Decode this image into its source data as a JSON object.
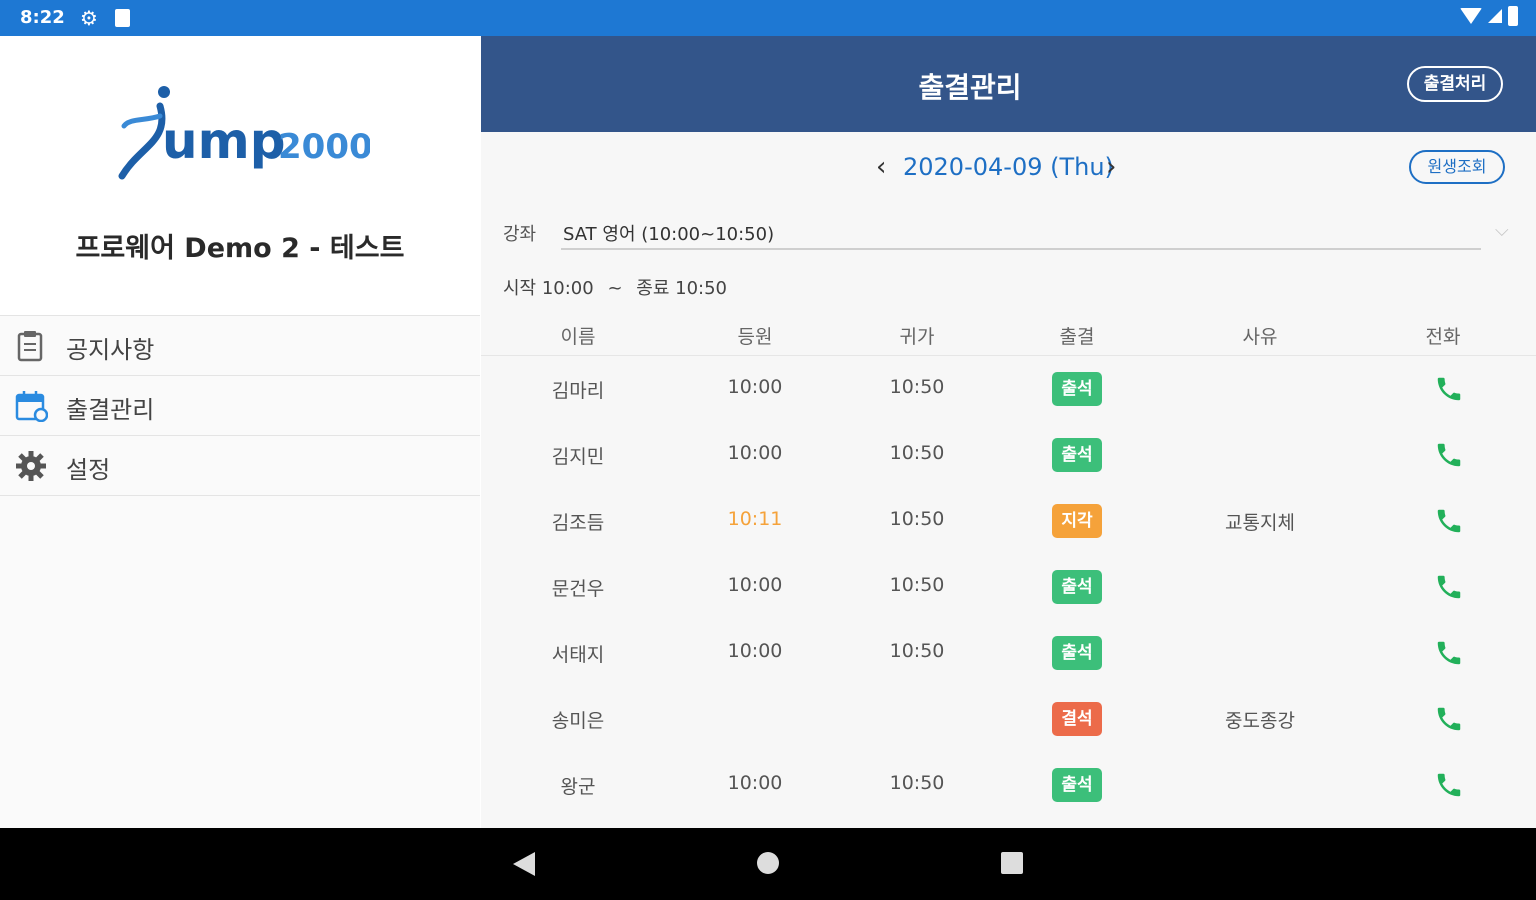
{
  "status_bar": {
    "time": "8:22"
  },
  "sidebar": {
    "org_name": "프로웨어 Demo 2 - 테스트",
    "items": [
      {
        "label": "공지사항",
        "icon": "notice-icon"
      },
      {
        "label": "출결관리",
        "icon": "calendar-icon"
      },
      {
        "label": "설정",
        "icon": "gear-icon"
      }
    ]
  },
  "appbar": {
    "title": "출결관리",
    "process_button": "출결처리"
  },
  "date_nav": {
    "date": "2020-04-09 (Thu)",
    "query_button": "원생조회"
  },
  "course": {
    "label": "강좌",
    "value": "SAT 영어 (10:00~10:50)"
  },
  "time_info": {
    "start": "시작 10:00",
    "sep": "~",
    "end": "종료 10:50"
  },
  "table": {
    "headers": [
      "이름",
      "등원",
      "귀가",
      "출결",
      "사유",
      "전화"
    ],
    "rows": [
      {
        "name": "김마리",
        "arrive": "10:00",
        "leave": "10:50",
        "status": "출석",
        "reason": ""
      },
      {
        "name": "김지민",
        "arrive": "10:00",
        "leave": "10:50",
        "status": "출석",
        "reason": ""
      },
      {
        "name": "김조듬",
        "arrive": "10:11",
        "leave": "10:50",
        "status": "지각",
        "reason": "교통지체"
      },
      {
        "name": "문건우",
        "arrive": "10:00",
        "leave": "10:50",
        "status": "출석",
        "reason": ""
      },
      {
        "name": "서태지",
        "arrive": "10:00",
        "leave": "10:50",
        "status": "출석",
        "reason": ""
      },
      {
        "name": "송미은",
        "arrive": "",
        "leave": "",
        "status": "결석",
        "reason": "중도종강"
      },
      {
        "name": "왕군",
        "arrive": "10:00",
        "leave": "10:50",
        "status": "출석",
        "reason": ""
      }
    ]
  },
  "colors": {
    "status_bar": "#1e78d3",
    "appbar": "#33558a",
    "present": "#3cbf7a",
    "late": "#f5a23a",
    "absent": "#ec6b4a",
    "phone": "#22b05a",
    "accent": "#1e6fc4"
  }
}
